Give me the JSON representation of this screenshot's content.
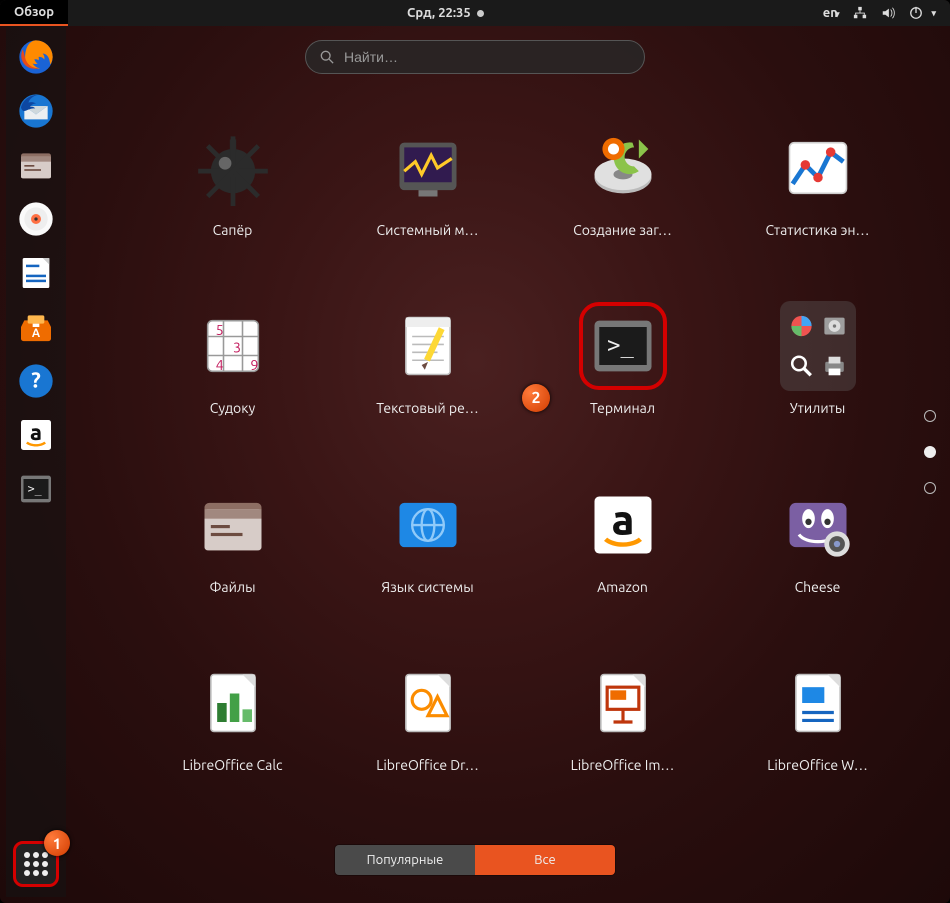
{
  "topbar": {
    "activities": "Обзор",
    "clock": "Срд, 22:35",
    "lang": "en"
  },
  "search": {
    "placeholder": "Найти…"
  },
  "dock": [
    {
      "name": "firefox"
    },
    {
      "name": "thunderbird"
    },
    {
      "name": "files"
    },
    {
      "name": "rhythmbox"
    },
    {
      "name": "writer"
    },
    {
      "name": "software"
    },
    {
      "name": "help"
    },
    {
      "name": "amazon"
    },
    {
      "name": "terminal"
    }
  ],
  "apps": [
    {
      "id": "mines",
      "label": "Сапёр"
    },
    {
      "id": "sysmon",
      "label": "Системный м…"
    },
    {
      "id": "startup",
      "label": "Создание заг…"
    },
    {
      "id": "powerstats",
      "label": "Статистика эн…"
    },
    {
      "id": "sudoku",
      "label": "Судоку"
    },
    {
      "id": "texteditor",
      "label": "Текстовый ре…"
    },
    {
      "id": "terminal",
      "label": "Терминал",
      "hl": true
    },
    {
      "id": "utilities",
      "label": "Утилиты",
      "folder": true
    },
    {
      "id": "files",
      "label": "Файлы"
    },
    {
      "id": "langsys",
      "label": "Язык системы"
    },
    {
      "id": "amazon",
      "label": "Amazon"
    },
    {
      "id": "cheese",
      "label": "Cheese"
    },
    {
      "id": "calc",
      "label": "LibreOffice Calc"
    },
    {
      "id": "draw",
      "label": "LibreOffice Dr…"
    },
    {
      "id": "impress",
      "label": "LibreOffice Im…"
    },
    {
      "id": "writer",
      "label": "LibreOffice W…"
    }
  ],
  "pager": {
    "total": 3,
    "active": 1
  },
  "tabs": {
    "frequent": "Популярные",
    "all": "Все"
  },
  "markers": {
    "1": "1",
    "2": "2"
  }
}
